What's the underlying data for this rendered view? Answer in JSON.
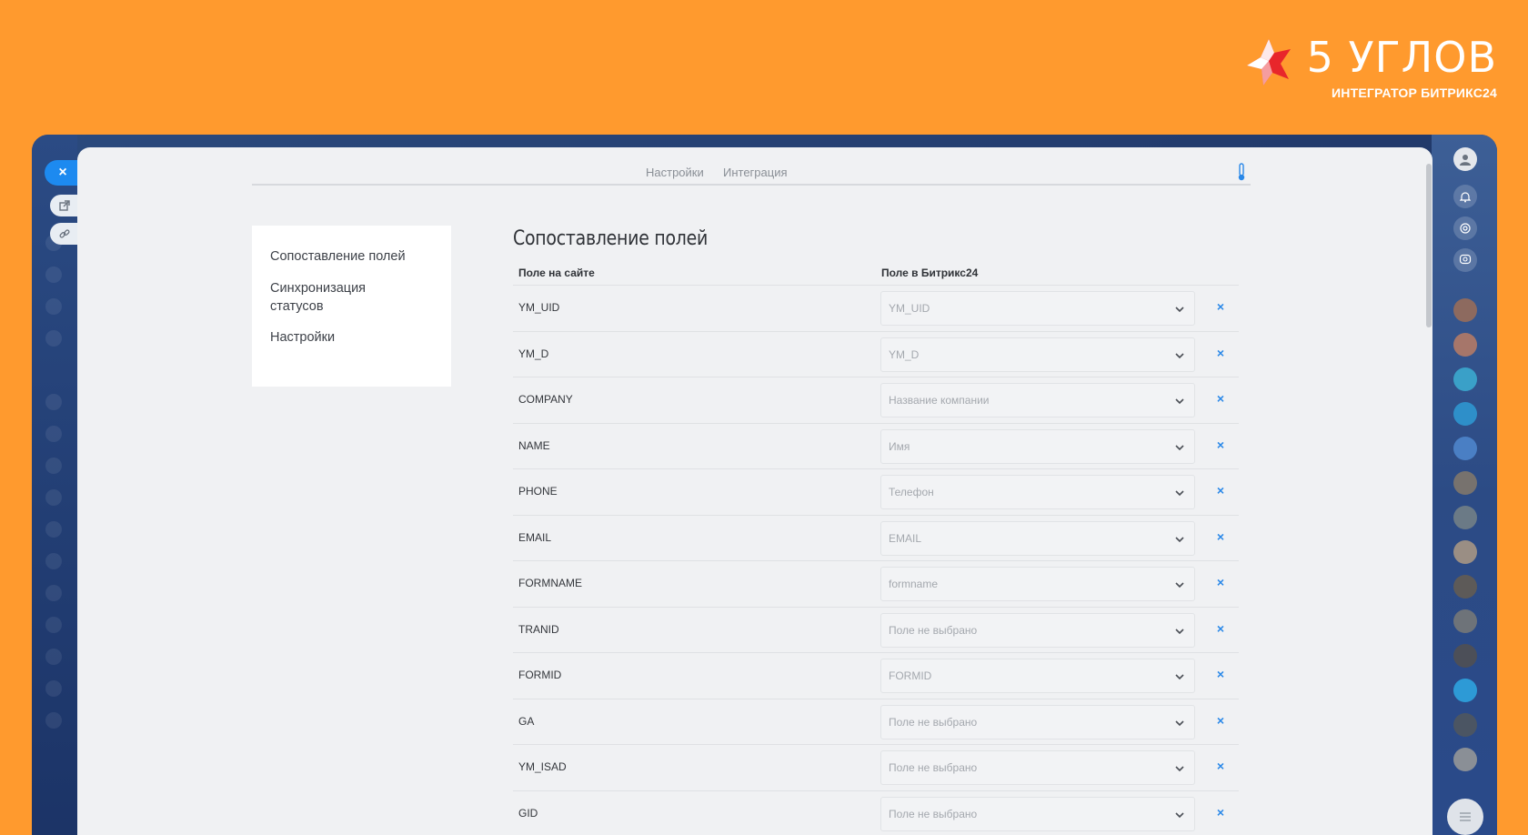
{
  "brand": {
    "title": "5 УГЛОВ",
    "subtitle": "ИНТЕГРАТОР БИТРИКС24"
  },
  "tabs": [
    {
      "label": "Настройки"
    },
    {
      "label": "Интеграция"
    }
  ],
  "menu": {
    "items": [
      {
        "label": "Сопоставление полей"
      },
      {
        "label": "Синхронизация статусов"
      },
      {
        "label": "Настройки"
      }
    ]
  },
  "section": {
    "title": "Сопоставление полей",
    "col_site": "Поле на сайте",
    "col_b24": "Поле в Битрикс24"
  },
  "rows": [
    {
      "field": "YM_UID",
      "value": "YM_UID"
    },
    {
      "field": "YM_D",
      "value": "YM_D"
    },
    {
      "field": "COMPANY",
      "value": "Название компании"
    },
    {
      "field": "NAME",
      "value": "Имя"
    },
    {
      "field": "PHONE",
      "value": "Телефон"
    },
    {
      "field": "EMAIL",
      "value": "EMAIL"
    },
    {
      "field": "FORMNAME",
      "value": "formname"
    },
    {
      "field": "TRANID",
      "value": "Поле не выбрано"
    },
    {
      "field": "FORMID",
      "value": "FORMID"
    },
    {
      "field": "GA",
      "value": "Поле не выбрано"
    },
    {
      "field": "YM_ISAD",
      "value": "Поле не выбрано"
    },
    {
      "field": "GID",
      "value": "Поле не выбрано"
    }
  ],
  "icons": {
    "close": "×",
    "remove": "×"
  },
  "colors": {
    "background": "#ff9a2e",
    "accent": "#2a88e8",
    "logo_red": "#e8262b"
  }
}
